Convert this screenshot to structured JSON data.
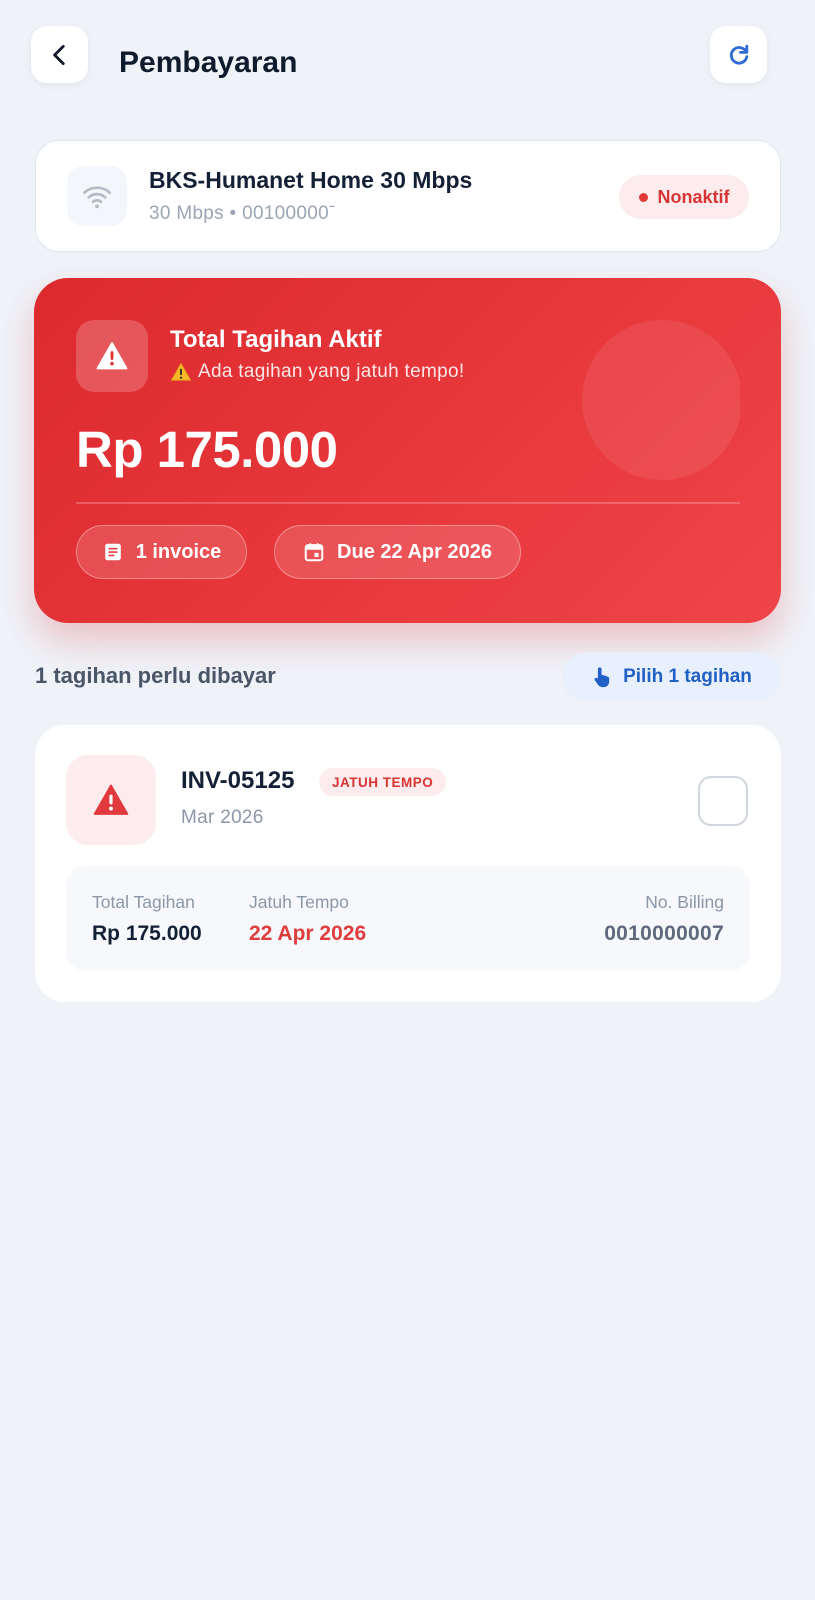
{
  "header": {
    "title": "Pembayaran",
    "back_icon": "chevron-left-icon",
    "refresh_icon": "refresh-icon"
  },
  "package": {
    "name": "BKS-Humanet Home 30 Mbps",
    "subtitle": "30 Mbps • 00100000ˉ",
    "icon": "wifi-icon",
    "status": "Nonaktif",
    "status_color": "#d93434"
  },
  "bill_summary": {
    "title": "Total Tagihan Aktif",
    "warning_emoji": "⚠️",
    "warning": "Ada tagihan yang jatuh tempo!",
    "amount": "Rp 175.000",
    "invoice_count_label": "1 invoice",
    "due_label": "Due 22 Apr 2026",
    "gradient_start": "#dc2a2e",
    "gradient_end": "#ee4448"
  },
  "section": {
    "title": "1 tagihan perlu dibayar",
    "select_label": "Pilih 1 tagihan"
  },
  "invoices": [
    {
      "number": "INV-05125",
      "badge": "JATUH TEMPO",
      "period": "Mar 2026",
      "checked": false,
      "total_label": "Total Tagihan",
      "total_value": "Rp 175.000",
      "due_label": "Jatuh Tempo",
      "due_value": "22 Apr 2026",
      "billing_label": "No. Billing",
      "billing_value": "0010000007"
    }
  ]
}
